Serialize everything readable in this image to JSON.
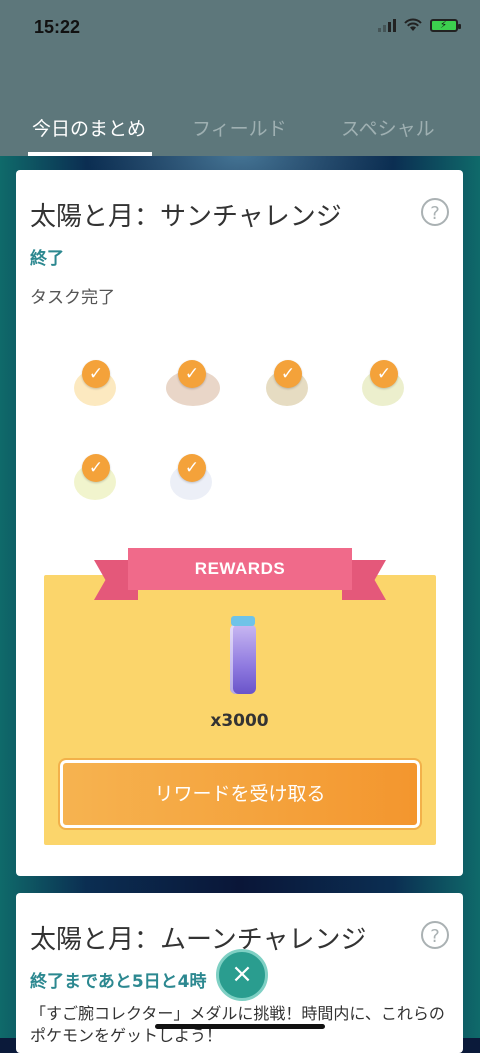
{
  "status_bar": {
    "time": "15:22"
  },
  "tabs": [
    {
      "label": "今日のまとめ",
      "active": true
    },
    {
      "label": "フィールド",
      "active": false
    },
    {
      "label": "スペシャル",
      "active": false
    }
  ],
  "sun_challenge": {
    "title": "太陽と月：サンチャレンジ",
    "help": "?",
    "status": "終了",
    "subtitle": "タスク完了",
    "tasks": [
      {
        "completed": true,
        "check": "✓"
      },
      {
        "completed": true,
        "check": "✓"
      },
      {
        "completed": true,
        "check": "✓"
      },
      {
        "completed": true,
        "check": "✓"
      },
      {
        "completed": true,
        "check": "✓"
      },
      {
        "completed": true,
        "check": "✓"
      }
    ],
    "rewards": {
      "banner": "REWARDS",
      "quantity": "x3000",
      "claim_label": "リワードを受け取る"
    }
  },
  "moon_challenge": {
    "title": "太陽と月：ムーンチャレンジ",
    "help": "?",
    "status": "終了まであと5日と4時",
    "description": "「すご腕コレクター」メダルに挑戦！時間内に、これらのポケモンをゲットしよう！"
  },
  "close_button": "×",
  "colors": {
    "header": "#5d777b",
    "accent_teal": "#2c8890",
    "check_orange": "#f4a23a",
    "ribbon_pink": "#f06a8a",
    "reward_yellow": "#fbd56b",
    "button_orange": "#f3962e"
  }
}
